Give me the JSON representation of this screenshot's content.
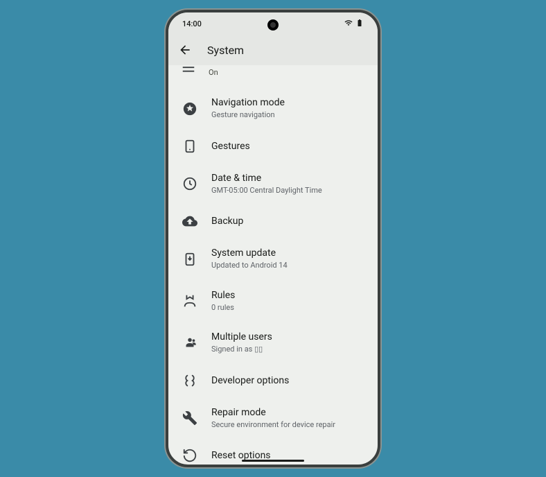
{
  "status": {
    "time": "14:00",
    "wifi": "▾",
    "battery": "▮"
  },
  "header": {
    "title": "System"
  },
  "partial": {
    "sub": "On"
  },
  "items": [
    {
      "icon": "navigation-mode-icon",
      "title": "Navigation mode",
      "sub": "Gesture navigation"
    },
    {
      "icon": "gestures-icon",
      "title": "Gestures",
      "sub": ""
    },
    {
      "icon": "clock-icon",
      "title": "Date & time",
      "sub": "GMT-05:00 Central Daylight Time"
    },
    {
      "icon": "backup-icon",
      "title": "Backup",
      "sub": ""
    },
    {
      "icon": "system-update-icon",
      "title": "System update",
      "sub": "Updated to Android 14"
    },
    {
      "icon": "rules-icon",
      "title": "Rules",
      "sub": "0 rules"
    },
    {
      "icon": "multiple-users-icon",
      "title": "Multiple users",
      "sub": "Signed in as ▯▯"
    },
    {
      "icon": "developer-options-icon",
      "title": "Developer options",
      "sub": ""
    },
    {
      "icon": "repair-mode-icon",
      "title": "Repair mode",
      "sub": "Secure environment for device repair"
    },
    {
      "icon": "reset-options-icon",
      "title": "Reset options",
      "sub": ""
    }
  ]
}
